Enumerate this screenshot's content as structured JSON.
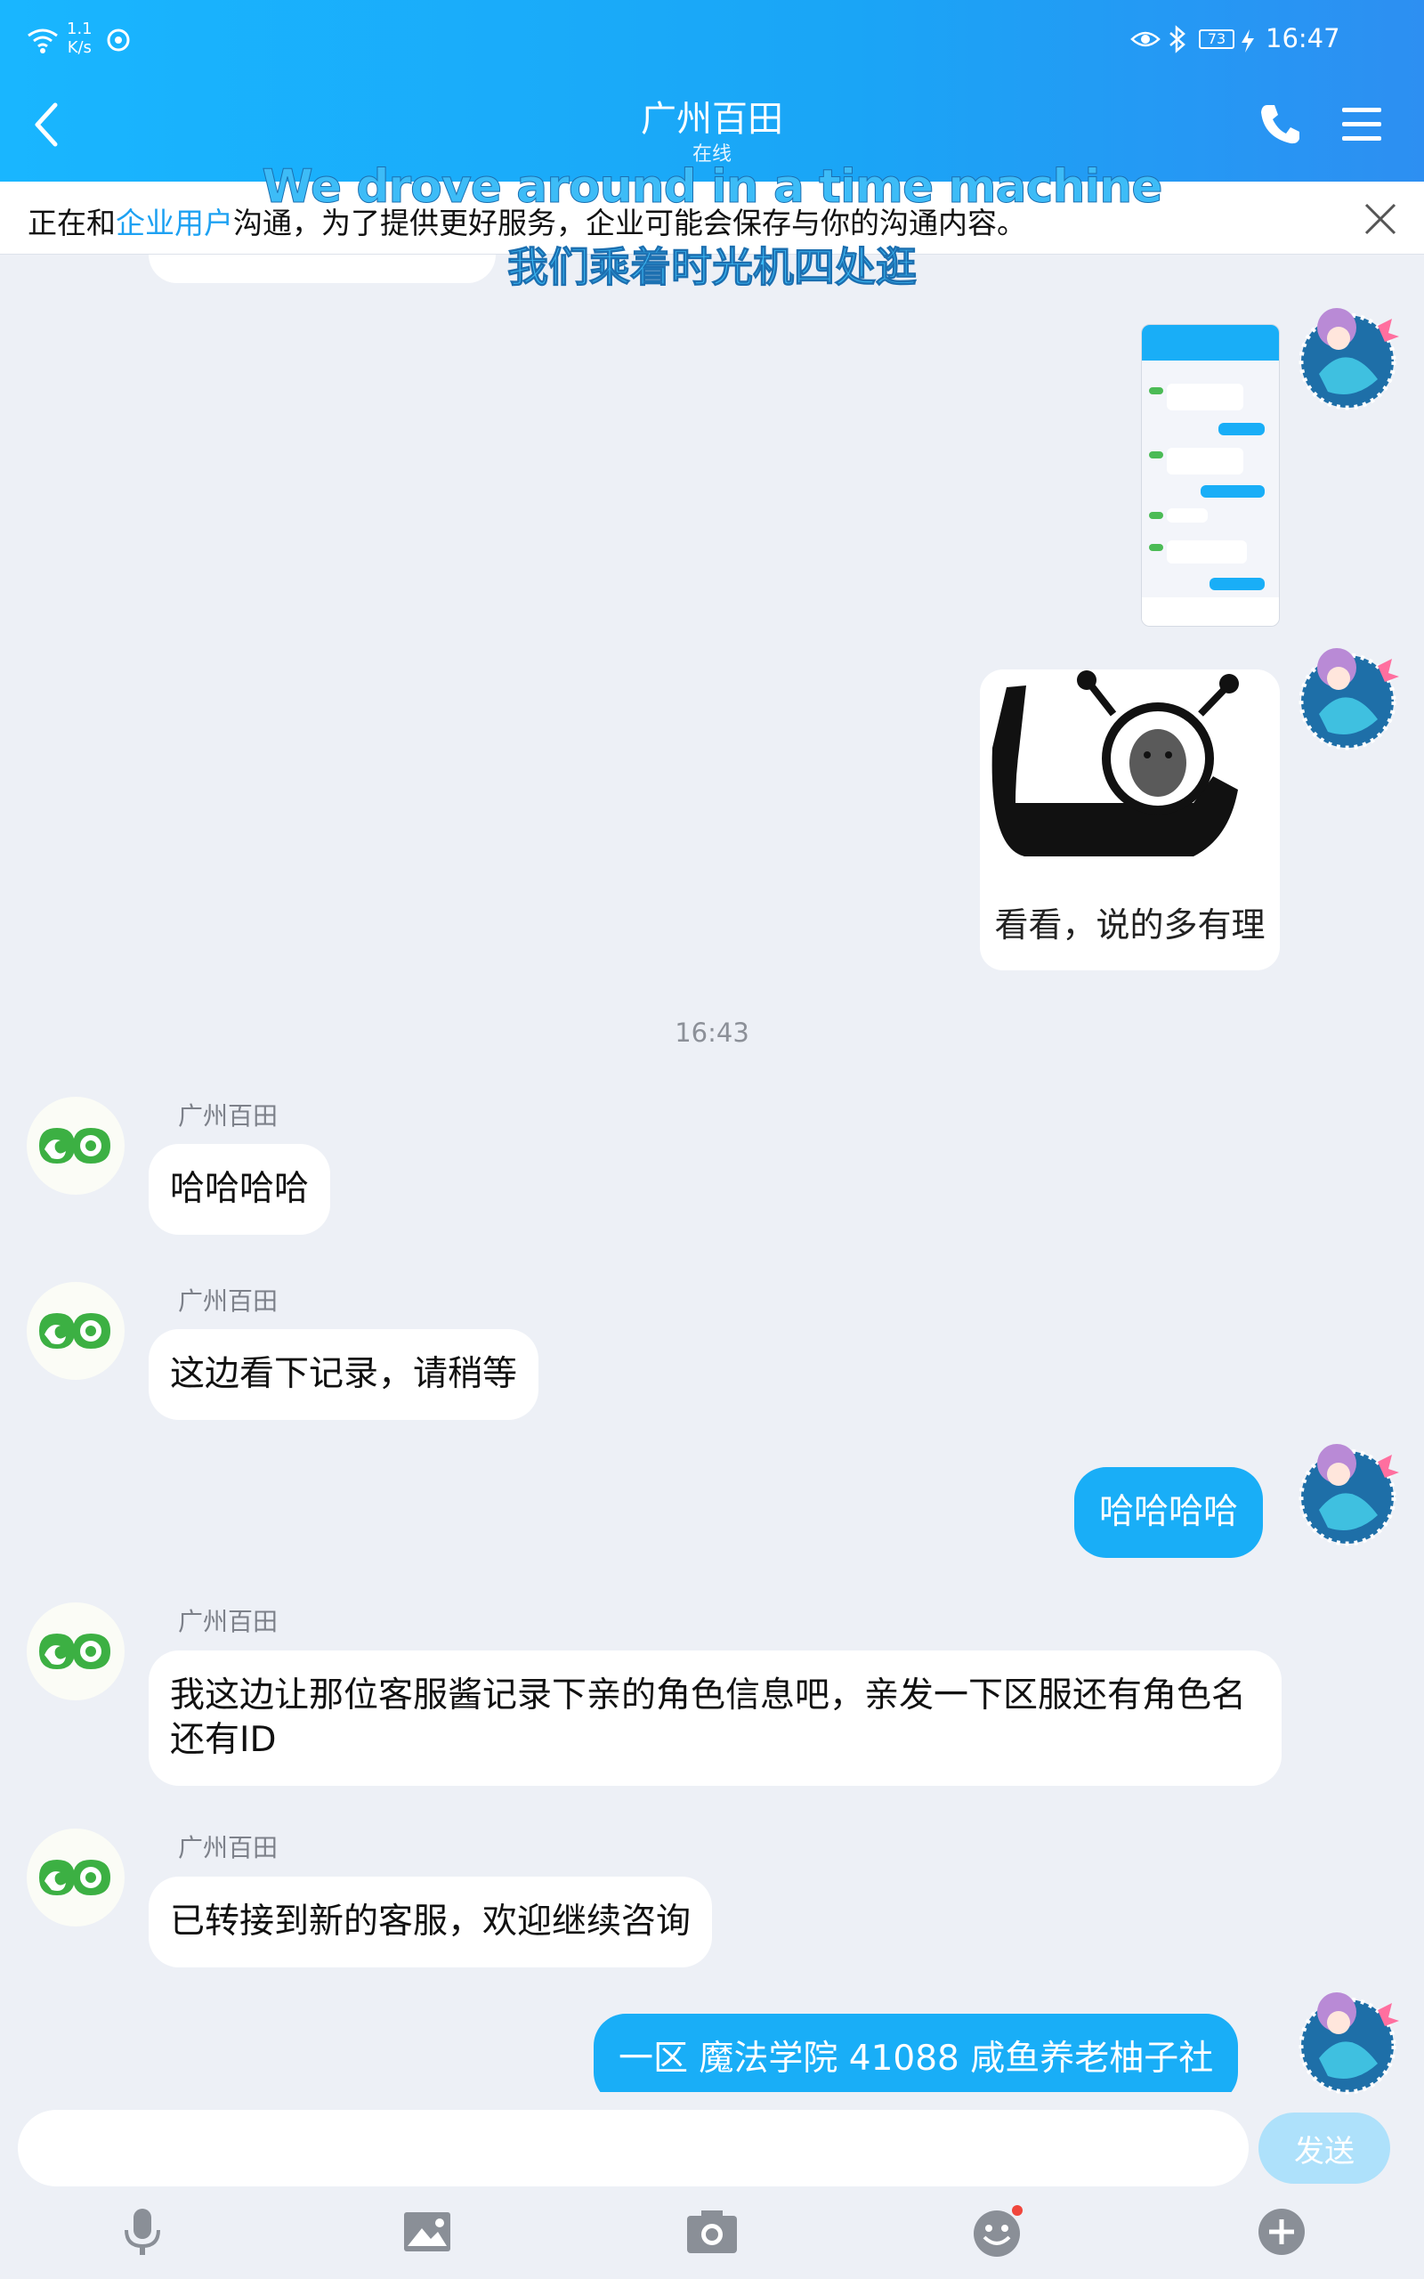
{
  "status_bar": {
    "speed_value": "1.1",
    "speed_unit": "K/s",
    "battery": "73",
    "time": "16:47"
  },
  "header": {
    "title": "广州百田",
    "subtitle": "在线"
  },
  "notice": {
    "prefix": "正在和",
    "link": "企业用户",
    "suffix": "沟通，为了提供更好服务，企业可能会保存与你的沟通内容。"
  },
  "overlay": {
    "english": "We drove around in a time machine",
    "chinese": "我们乘着时光机四处逛"
  },
  "meme_caption": "看看，说的多有理",
  "time_separator": "16:43",
  "messages": [
    {
      "sender": "广州百田",
      "text": "哈哈哈哈"
    },
    {
      "sender": "广州百田",
      "text": "这边看下记录，请稍等"
    },
    {
      "sender": "me",
      "text": "哈哈哈哈"
    },
    {
      "sender": "广州百田",
      "text": "我这边让那位客服酱记录下亲的角色信息吧，亲发一下区服还有角色名还有ID"
    },
    {
      "sender": "广州百田",
      "text": "已转接到新的客服，欢迎继续咨询"
    },
    {
      "sender": "me",
      "text": "一区 魔法学院 41088 咸鱼养老柚子社"
    }
  ],
  "input": {
    "placeholder": "",
    "send_label": "发送"
  },
  "toolbar": [
    "mic-icon",
    "image-icon",
    "camera-icon",
    "emoji-icon",
    "plus-icon"
  ],
  "colors": {
    "header": "#1aa5f6",
    "accent": "#19aef7",
    "send_disabled": "#aee1fb",
    "background": "#edf0f6"
  }
}
